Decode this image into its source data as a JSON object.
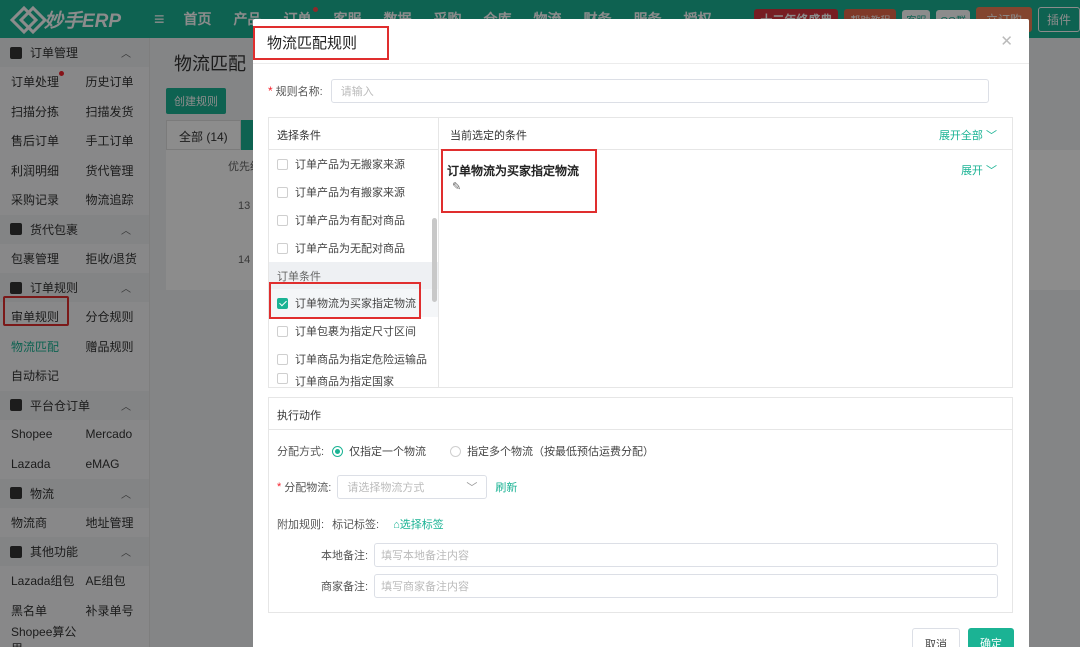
{
  "brand": {
    "name": "妙手ERP"
  },
  "topnav": {
    "items": [
      "首页",
      "产品",
      "订单",
      "客服",
      "数据",
      "采购",
      "仓库",
      "物流",
      "财务",
      "服务",
      "授权"
    ],
    "promo": "十二年终盛典",
    "badge_help": "帮助教程",
    "badge_kefu": "客服",
    "badge_qq": "QQ群",
    "btn_order": "立订购",
    "btn_plugin": "插件"
  },
  "sidebar": {
    "groups": [
      {
        "title": "订单管理",
        "rows": [
          [
            "订单处理",
            "历史订单"
          ],
          [
            "扫描分拣",
            "扫描发货"
          ],
          [
            "售后订单",
            "手工订单"
          ],
          [
            "利润明细",
            "货代管理"
          ],
          [
            "采购记录",
            "物流追踪"
          ]
        ]
      },
      {
        "title": "货代包裹",
        "rows": [
          [
            "包裹管理",
            "拒收/退货"
          ]
        ]
      },
      {
        "title": "订单规则",
        "rows": [
          [
            "审单规则",
            "分仓规则"
          ],
          [
            "物流匹配",
            "赠品规则"
          ],
          [
            "自动标记",
            ""
          ]
        ]
      },
      {
        "title": "平台仓订单",
        "rows": [
          [
            "Shopee",
            "Mercado"
          ],
          [
            "Lazada",
            "eMAG"
          ]
        ]
      },
      {
        "title": "物流",
        "rows": [
          [
            "物流商",
            "地址管理"
          ]
        ]
      },
      {
        "title": "其他功能",
        "rows": [
          [
            "Lazada组包",
            "AE组包"
          ],
          [
            "黑名单",
            "补录单号"
          ],
          [
            "Shopee算公里",
            ""
          ]
        ]
      }
    ]
  },
  "main": {
    "title": "物流匹配",
    "create_btn": "创建规则",
    "tab_all": "全部 (14)",
    "col_priority": "优先级",
    "row1_priority": "13",
    "row2_priority": "14"
  },
  "modal": {
    "title": "物流匹配规则",
    "rule_name_label": "规则名称:",
    "rule_name_placeholder": "请输入",
    "select_cond_header": "选择条件",
    "current_cond_header": "当前选定的条件",
    "expand_all": "展开全部",
    "cond_items": [
      {
        "label": "订单产品为无搬家来源",
        "checked": false
      },
      {
        "label": "订单产品为有搬家来源",
        "checked": false
      },
      {
        "label": "订单产品为有配对商品",
        "checked": false
      },
      {
        "label": "订单产品为无配对商品",
        "checked": false
      }
    ],
    "section_label": "订单条件",
    "cond_items2": [
      {
        "label": "订单物流为买家指定物流",
        "checked": true
      },
      {
        "label": "订单包裹为指定尺寸区间",
        "checked": false
      },
      {
        "label": "订单商品为指定危险运输品",
        "checked": false
      },
      {
        "label": "订单商品为指定国家",
        "checked": false
      }
    ],
    "selected_condition": "订单物流为买家指定物流",
    "expand": "展开",
    "action_header": "执行动作",
    "assign_mode_label": "分配方式:",
    "mode_single": "仅指定一个物流",
    "mode_multi": "指定多个物流（按最低预估运费分配）",
    "assign_logistics_label": "分配物流:",
    "logistics_placeholder": "请选择物流方式",
    "refresh": "刷新",
    "extra_rule_label": "附加规则:",
    "tag_label": "标记标签:",
    "select_tag": "选择标签",
    "local_note_label": "本地备注:",
    "local_note_placeholder": "填写本地备注内容",
    "merchant_note_label": "商家备注:",
    "merchant_note_placeholder": "填写商家备注内容",
    "cancel": "取消",
    "confirm": "确定"
  }
}
